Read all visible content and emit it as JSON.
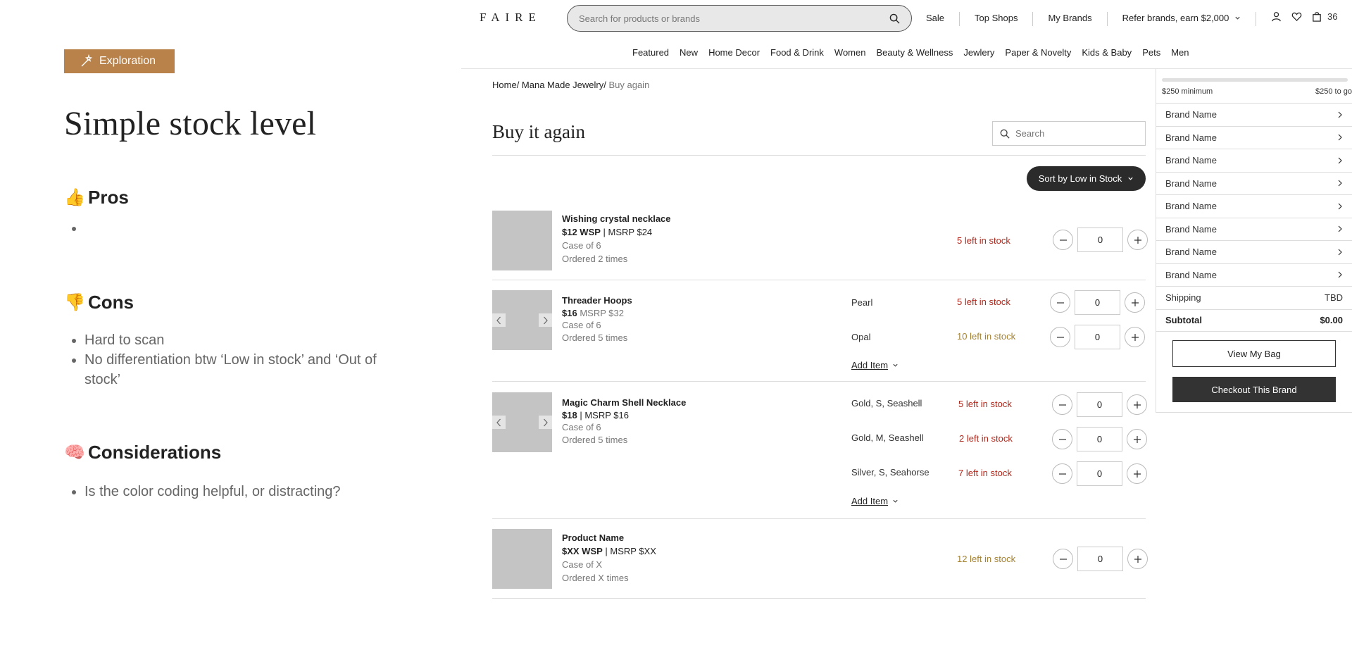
{
  "notes": {
    "tag": "Exploration",
    "title": "Simple stock level",
    "pros": {
      "emoji": "👍",
      "heading": "Pros",
      "items": [
        ""
      ]
    },
    "cons": {
      "emoji": "👎",
      "heading": "Cons",
      "items": [
        "Hard to scan",
        "No differentiation btw ‘Low in stock’ and ‘Out of stock’"
      ]
    },
    "considerations": {
      "emoji": "🧠",
      "heading": "Considerations",
      "items": [
        "Is the color coding helpful, or distracting?"
      ]
    }
  },
  "header": {
    "logo": "FAIRE",
    "search_placeholder": "Search for products or brands",
    "nav": [
      "Sale",
      "Top Shops",
      "My Brands",
      "Refer brands, earn $2,000"
    ],
    "cart_count": "36",
    "categories": [
      "Featured",
      "New",
      "Home Decor",
      "Food & Drink",
      "Women",
      "Beauty & Wellness",
      "Jewlery",
      "Paper & Novelty",
      "Kids & Baby",
      "Pets",
      "Men"
    ]
  },
  "breadcrumb": {
    "home": "Home",
    "brand": "Mana Made Jewelry",
    "current": "Buy again"
  },
  "page": {
    "title": "Buy it again",
    "search_placeholder": "Search",
    "sort_label": "Sort by Low in Stock",
    "add_item_label": "Add Item"
  },
  "products": [
    {
      "name": "Wishing crystal necklace",
      "wsp": "$12 WSP",
      "msrp": "| MSRP $24",
      "case": "Case of 6",
      "ordered": "Ordered 2 times",
      "variants": [
        {
          "label": "",
          "stock": "5 left in stock",
          "qty": "0"
        }
      ]
    },
    {
      "name": "Threader Hoops",
      "wsp": "$16",
      "msrp": "MSRP $32",
      "case": "Case of 6",
      "ordered": "Ordered 5 times",
      "variants": [
        {
          "label": "Pearl",
          "stock": "5 left in stock",
          "qty": "0"
        },
        {
          "label": "Opal",
          "stock": "10 left in stock",
          "qty": "0"
        }
      ]
    },
    {
      "name": "Magic Charm Shell Necklace",
      "wsp": "$18",
      "msrp": "| MSRP $16",
      "case": "Case of 6",
      "ordered": "Ordered 5 times",
      "variants": [
        {
          "label": "Gold, S, Seashell",
          "stock": "5 left in stock",
          "qty": "0"
        },
        {
          "label": "Gold, M, Seashell",
          "stock": "2 left in stock",
          "qty": "0"
        },
        {
          "label": "Silver, S, Seahorse",
          "stock": "7 left in stock",
          "qty": "0"
        }
      ]
    },
    {
      "name": "Product Name",
      "wsp": "$XX WSP",
      "msrp": "| MSRP $XX",
      "case": "Case of X",
      "ordered": "Ordered X times",
      "variants": [
        {
          "label": "",
          "stock": "12 left in stock",
          "qty": "0"
        }
      ]
    }
  ],
  "colors": {
    "stock_low": "#b0281c",
    "stock_medium": "#a58230",
    "tag_bg": "#b8824a"
  },
  "cart": {
    "minimum": "$250 minimum",
    "to_go": "$250 to go",
    "progress": 0.0,
    "brands": [
      "Brand Name",
      "Brand Name",
      "Brand Name",
      "Brand Name",
      "Brand Name",
      "Brand Name",
      "Brand Name",
      "Brand Name"
    ],
    "shipping_label": "Shipping",
    "shipping_value": "TBD",
    "subtotal_label": "Subtotal",
    "subtotal_value": "$0.00",
    "view_bag": "View My Bag",
    "checkout": "Checkout This Brand"
  }
}
